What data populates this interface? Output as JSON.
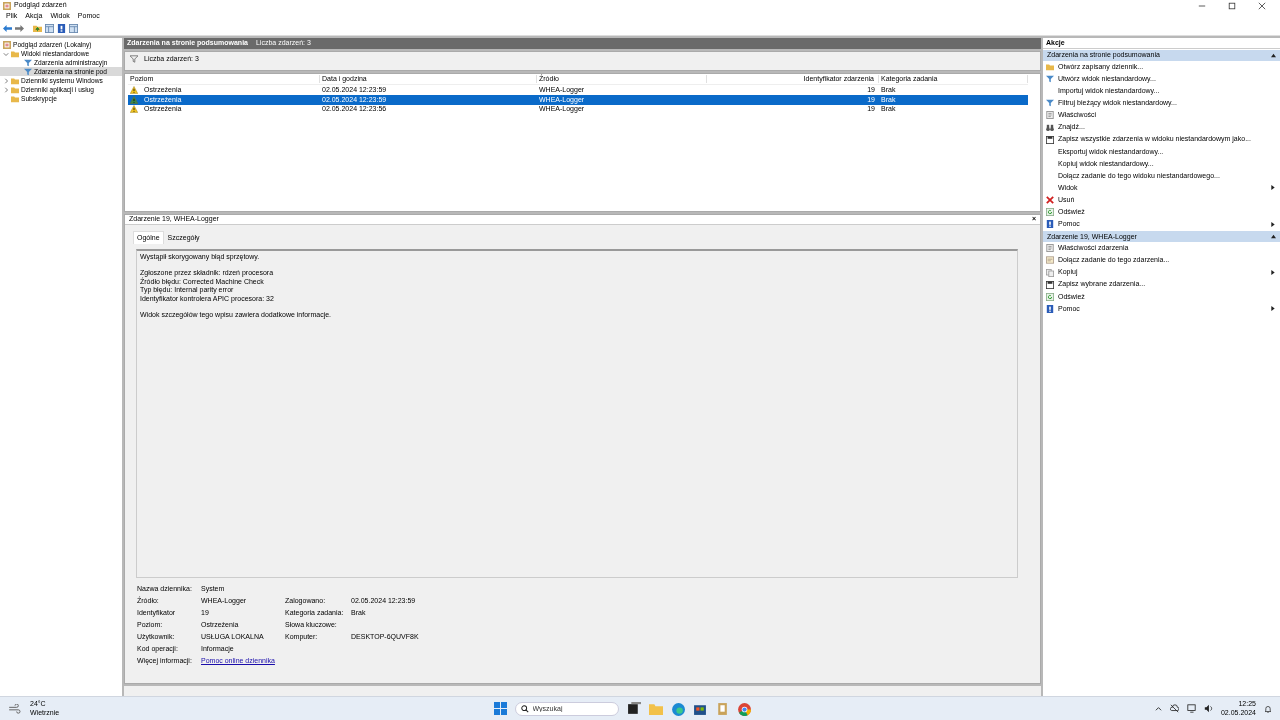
{
  "window": {
    "title": "Podgląd zdarzeń"
  },
  "menu": [
    "Plik",
    "Akcja",
    "Widok",
    "Pomoc"
  ],
  "tree": [
    {
      "label": "Podgląd zdarzeń (Lokalny)",
      "kind": "viewer",
      "selected": false,
      "children": [
        {
          "label": "Widoki niestandardowe",
          "kind": "folder",
          "expanded": true,
          "selected": false,
          "children": [
            {
              "label": "Zdarzenia administracyjn",
              "kind": "filter",
              "selected": false
            },
            {
              "label": "Zdarzenia na stronie pod",
              "kind": "filter",
              "selected": true
            }
          ]
        },
        {
          "label": "Dzienniki systemu Windows",
          "kind": "folder",
          "expanded": false,
          "selected": false
        },
        {
          "label": "Dzienniki aplikacji i usług",
          "kind": "folder",
          "expanded": false,
          "selected": false
        },
        {
          "label": "Subskrypcje",
          "kind": "folder",
          "selected": false
        }
      ]
    }
  ],
  "view": {
    "title": "Zdarzenia na stronie podsumowania",
    "count": "Liczba zdarzeń: 3",
    "filter_text": "Liczba zdarzeń: 3"
  },
  "table": {
    "columns": [
      "Poziom",
      "Data i godzina",
      "Źródło",
      "Identyfikator zdarzenia",
      "Kategoria zadania"
    ],
    "rows": [
      {
        "cells": [
          "Ostrzeżenia",
          "02.05.2024 12:23:59",
          "WHEA-Logger",
          "19",
          "Brak"
        ],
        "selected": false
      },
      {
        "cells": [
          "Ostrzeżenia",
          "02.05.2024 12:23:59",
          "WHEA-Logger",
          "19",
          "Brak"
        ],
        "selected": true
      },
      {
        "cells": [
          "Ostrzeżenia",
          "02.05.2024 12:23:56",
          "WHEA-Logger",
          "19",
          "Brak"
        ],
        "selected": false
      }
    ]
  },
  "detail": {
    "title": "Zdarzenie 19, WHEA-Logger",
    "close": "×",
    "tabs": [
      {
        "label": "Ogólne",
        "selected": true
      },
      {
        "label": "Szczegóły",
        "selected": false
      }
    ],
    "description": [
      [
        "Wystąpił skorygowany błąd sprzętowy."
      ],
      [
        "Zgłoszone przez składnik: rdzeń procesora",
        "Źródło błędu: Corrected Machine Check",
        "Typ błędu: Internal parity error",
        "Identyfikator kontrolera APIC procesora: 32"
      ],
      [
        "Widok szczegółów tego wpisu zawiera dodatkowe informacje."
      ]
    ],
    "properties": [
      [
        {
          "label": "Nazwa dziennika:",
          "value": "System"
        }
      ],
      [
        {
          "label": "Źródło:",
          "value": "WHEA-Logger"
        },
        {
          "label": "Zalogowano:",
          "value": "02.05.2024 12:23:59"
        }
      ],
      [
        {
          "label": "Identyfikator",
          "value": "19"
        },
        {
          "label": "Kategoria zadania:",
          "value": "Brak"
        }
      ],
      [
        {
          "label": "Poziom:",
          "value": "Ostrzeżenia"
        },
        {
          "label": "Słowa kluczowe:"
        }
      ],
      [
        {
          "label": "Użytkownik:",
          "value": "USŁUGA LOKALNA"
        },
        {
          "label": "Komputer:",
          "value": "DESKTOP-6QUVF8K"
        }
      ],
      [
        {
          "label": "Kod operacji:",
          "value": "Informacje"
        }
      ],
      [
        {
          "label": "Więcej informacji:",
          "link": "Pomoc online dziennika"
        }
      ]
    ]
  },
  "actions": {
    "title": "Akcje",
    "sections": [
      {
        "title": "Zdarzenia na stronie podsumowania",
        "expanded": true,
        "items": [
          {
            "label": "Otwórz zapisany dziennik...",
            "kind": "folder"
          },
          {
            "label": "Utwórz widok niestandardowy...",
            "kind": "filter"
          },
          {
            "label": "Importuj widok niestandardowy..."
          },
          {
            "label": "Filtruj bieżący widok niestandardowy...",
            "kind": "filter"
          },
          {
            "label": "Właściwości",
            "kind": "properties"
          },
          {
            "label": "Znajdź...",
            "kind": "find"
          },
          {
            "label": "Zapisz wszystkie zdarzenia w widoku niestandardowym jako...",
            "kind": "save"
          },
          {
            "label": "Eksportuj widok niestandardowy..."
          },
          {
            "label": "Kopiuj widok niestandardowy..."
          },
          {
            "label": "Dołącz zadanie do tego widoku niestandardowego..."
          },
          {
            "label": "Widok",
            "submenu": true
          },
          {
            "label": "Usuń",
            "kind": "delete"
          },
          {
            "label": "Odśwież",
            "kind": "refresh"
          },
          {
            "label": "Pomoc",
            "kind": "help",
            "submenu": true
          }
        ]
      },
      {
        "title": "Zdarzenie 19, WHEA-Logger",
        "expanded": true,
        "items": [
          {
            "label": "Właściwości zdarzenia",
            "kind": "properties"
          },
          {
            "label": "Dołącz zadanie do tego zdarzenia...",
            "kind": "task"
          },
          {
            "label": "Kopiuj",
            "kind": "copy",
            "submenu": true
          },
          {
            "label": "Zapisz wybrane zdarzenia...",
            "kind": "save"
          },
          {
            "label": "Odśwież",
            "kind": "refresh"
          },
          {
            "label": "Pomoc",
            "kind": "help",
            "submenu": true
          }
        ]
      }
    ]
  },
  "taskbar": {
    "temperature": "24°C",
    "weather": "Wietrznie",
    "search_placeholder": "Wyszukaj",
    "time": "12:25",
    "date": "02.05.2024"
  }
}
